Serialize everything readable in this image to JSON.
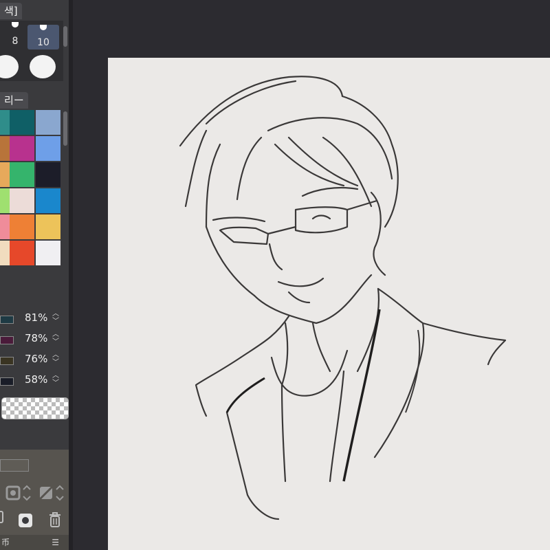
{
  "brush_panel": {
    "tab_label": "색]",
    "sizes": [
      {
        "label": "8",
        "selected": false
      },
      {
        "label": "10",
        "selected": true
      }
    ]
  },
  "palette_panel": {
    "tab_label": "리ー",
    "swatches": [
      [
        "#2f8d8a",
        "#0f5f66",
        "#8aa7cf"
      ],
      [
        "#b8743a",
        "#b8328e",
        "#6e9fe8"
      ],
      [
        "#e7a95b",
        "#35b46c",
        "#1c1d29"
      ],
      [
        "#9fe070",
        "#ecdcd8",
        "#1a87cc"
      ],
      [
        "#ef8c9a",
        "#ee8035",
        "#edc35a"
      ],
      [
        "#f1dcbf",
        "#e6482a",
        "#f0eff2"
      ]
    ]
  },
  "layer_opacity": [
    {
      "color": "#1e3a44",
      "value": "81%"
    },
    {
      "color": "#4a1b3a",
      "value": "78%"
    },
    {
      "color": "#3a3422",
      "value": "76%"
    },
    {
      "color": "#1a1d28",
      "value": "58%"
    }
  ],
  "footer": {
    "label": "币"
  },
  "colors": {
    "panel": "#3a3a3d",
    "canvas_bg": "#2c2b30",
    "paper": "#ebe9e7",
    "accent_selected": "#4b5770"
  }
}
